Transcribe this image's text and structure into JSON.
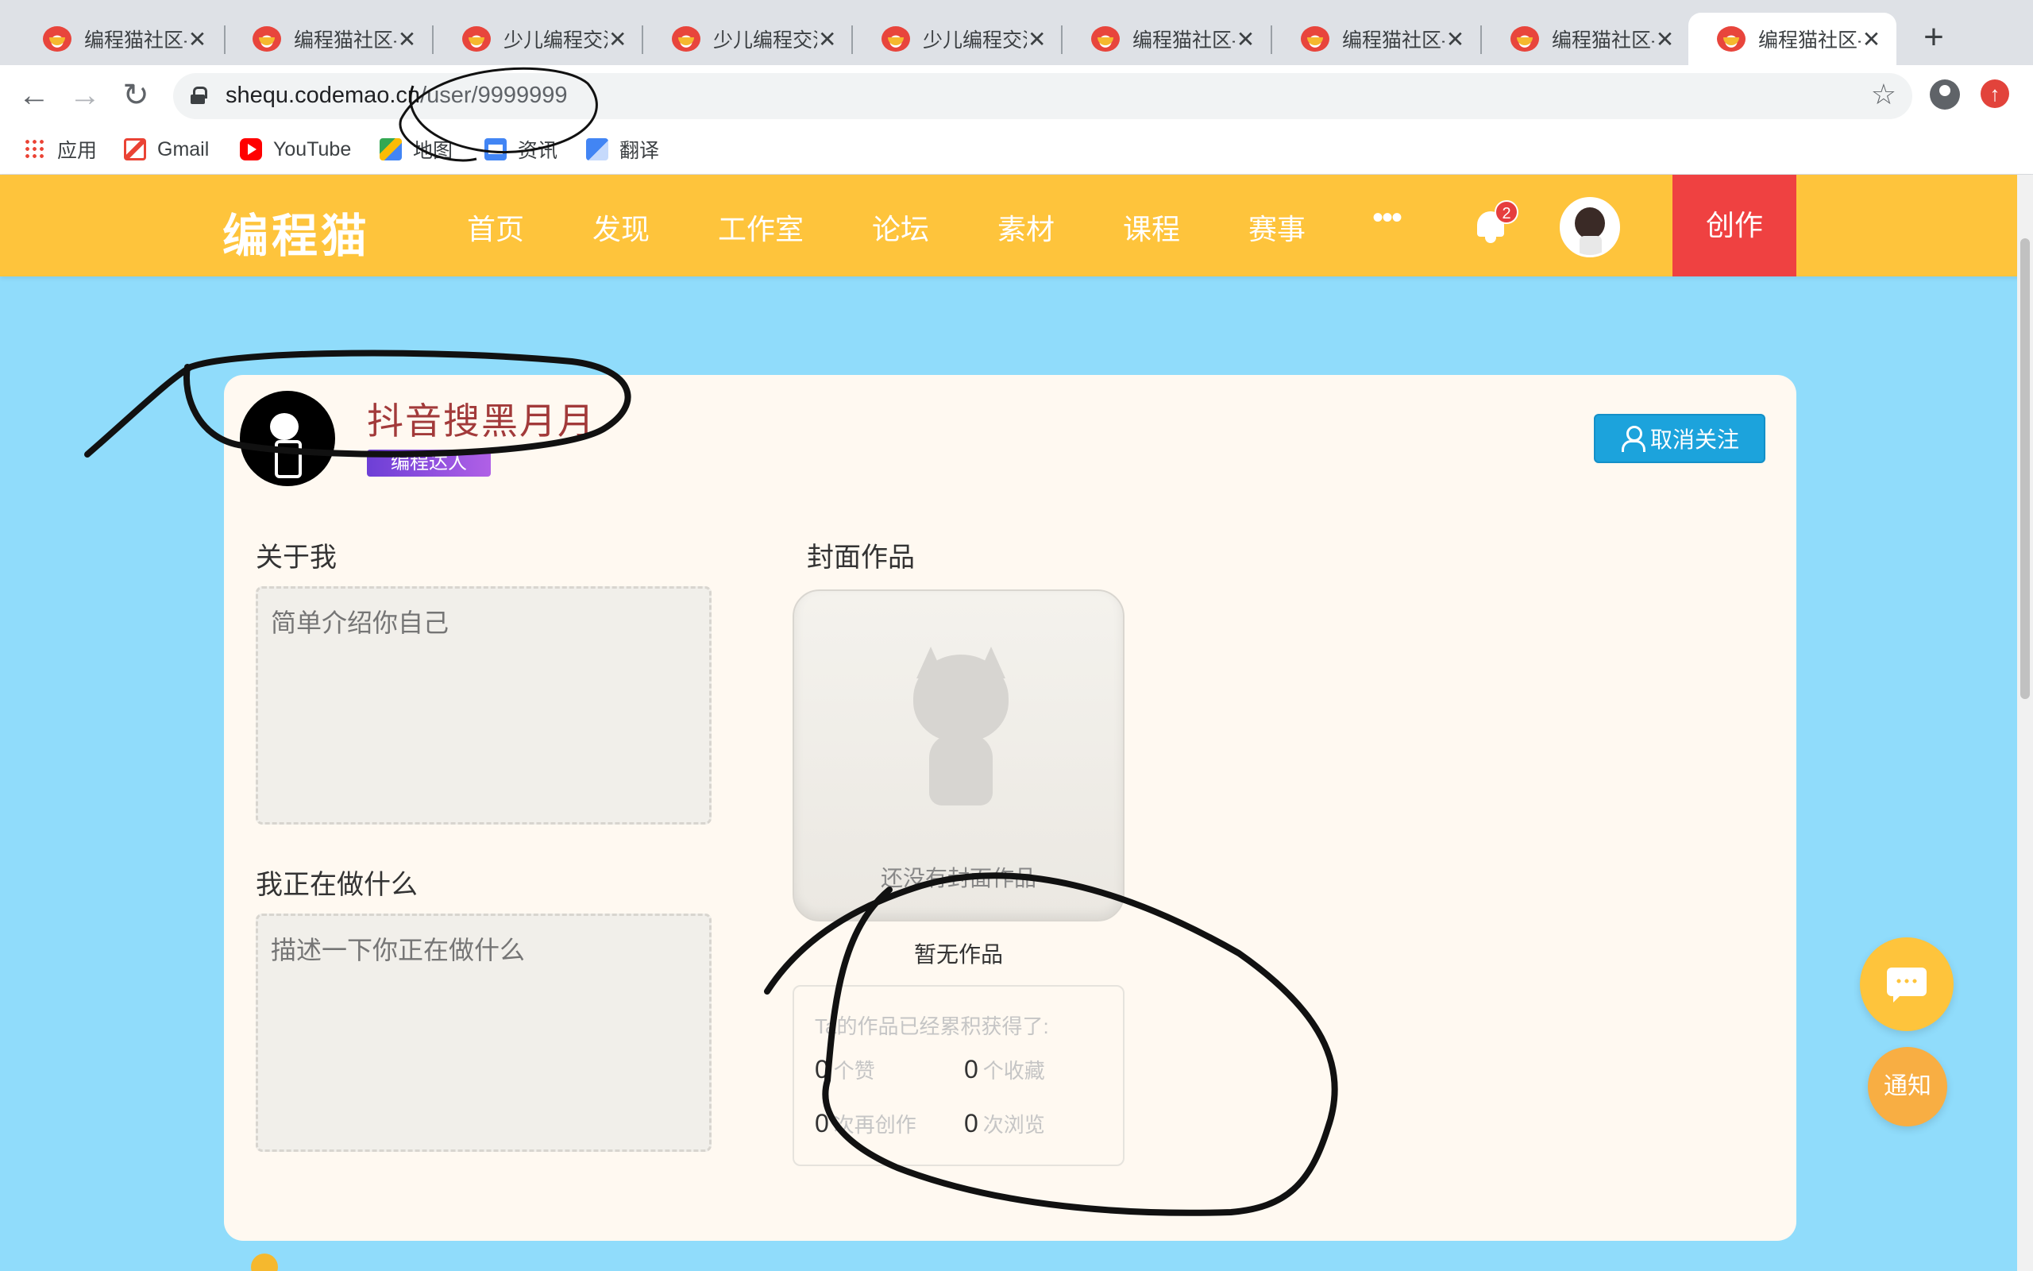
{
  "browser": {
    "tabs": [
      {
        "title": "编程猫社区-",
        "active": false
      },
      {
        "title": "编程猫社区-",
        "active": false
      },
      {
        "title": "少儿编程交流",
        "active": false
      },
      {
        "title": "少儿编程交流",
        "active": false
      },
      {
        "title": "少儿编程交流",
        "active": false
      },
      {
        "title": "编程猫社区-",
        "active": false
      },
      {
        "title": "编程猫社区-",
        "active": false
      },
      {
        "title": "编程猫社区-",
        "active": false
      },
      {
        "title": "编程猫社区-",
        "active": true
      }
    ],
    "tab_close": "✕",
    "new_tab": "+",
    "url_host": "shequ.codemao.cn",
    "url_path": "/user/9999999",
    "bookmarks": [
      "应用",
      "Gmail",
      "YouTube",
      "地图",
      "资讯",
      "翻译"
    ]
  },
  "header": {
    "logo": "编程猫",
    "nav": [
      "首页",
      "发现",
      "工作室",
      "论坛",
      "素材",
      "课程",
      "赛事",
      "•••"
    ],
    "notification_count": "2",
    "create_label": "创作",
    "brand_color": "#fec43c",
    "create_color": "#ef4141"
  },
  "profile": {
    "username": "抖音搜黑月月",
    "level": "编程达人",
    "unfollow_label": "取消关注",
    "about_title": "关于我",
    "about_placeholder": "简单介绍你自己",
    "doing_title": "我正在做什么",
    "doing_placeholder": "描述一下你正在做什么",
    "cover_title": "封面作品",
    "cover_empty": "还没有封面作品",
    "no_works": "暂无作品",
    "stats_title": "Ta的作品已经累积获得了:",
    "stats": {
      "likes": {
        "value": "0",
        "label": "个赞"
      },
      "favorites": {
        "value": "0",
        "label": "个收藏"
      },
      "remixes": {
        "value": "0",
        "label": "次再创作"
      },
      "views": {
        "value": "0",
        "label": "次浏览"
      }
    }
  },
  "floating": {
    "notify_label": "通知"
  }
}
